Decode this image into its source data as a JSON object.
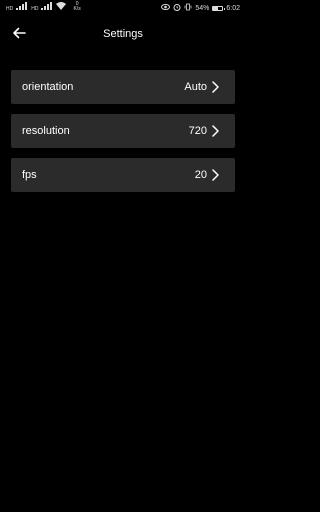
{
  "status_bar": {
    "sim1": "HD",
    "sim2": "HD",
    "net_speed_value": "0",
    "net_speed_unit": "K/s",
    "battery_text": "54%",
    "battery_level": 0.54,
    "time": "6:02",
    "icons": [
      "signal-icon",
      "wifi-icon",
      "eye-icon",
      "alarm-icon",
      "vibrate-icon",
      "battery-icon"
    ]
  },
  "header": {
    "title": "Settings",
    "back_icon": "back-arrow-icon"
  },
  "settings": [
    {
      "label": "orientation",
      "value": "Auto"
    },
    {
      "label": "resolution",
      "value": "720"
    },
    {
      "label": "fps",
      "value": "20"
    }
  ],
  "colors": {
    "background": "#000000",
    "row_background": "#2b2b2b",
    "text": "#ffffff"
  }
}
